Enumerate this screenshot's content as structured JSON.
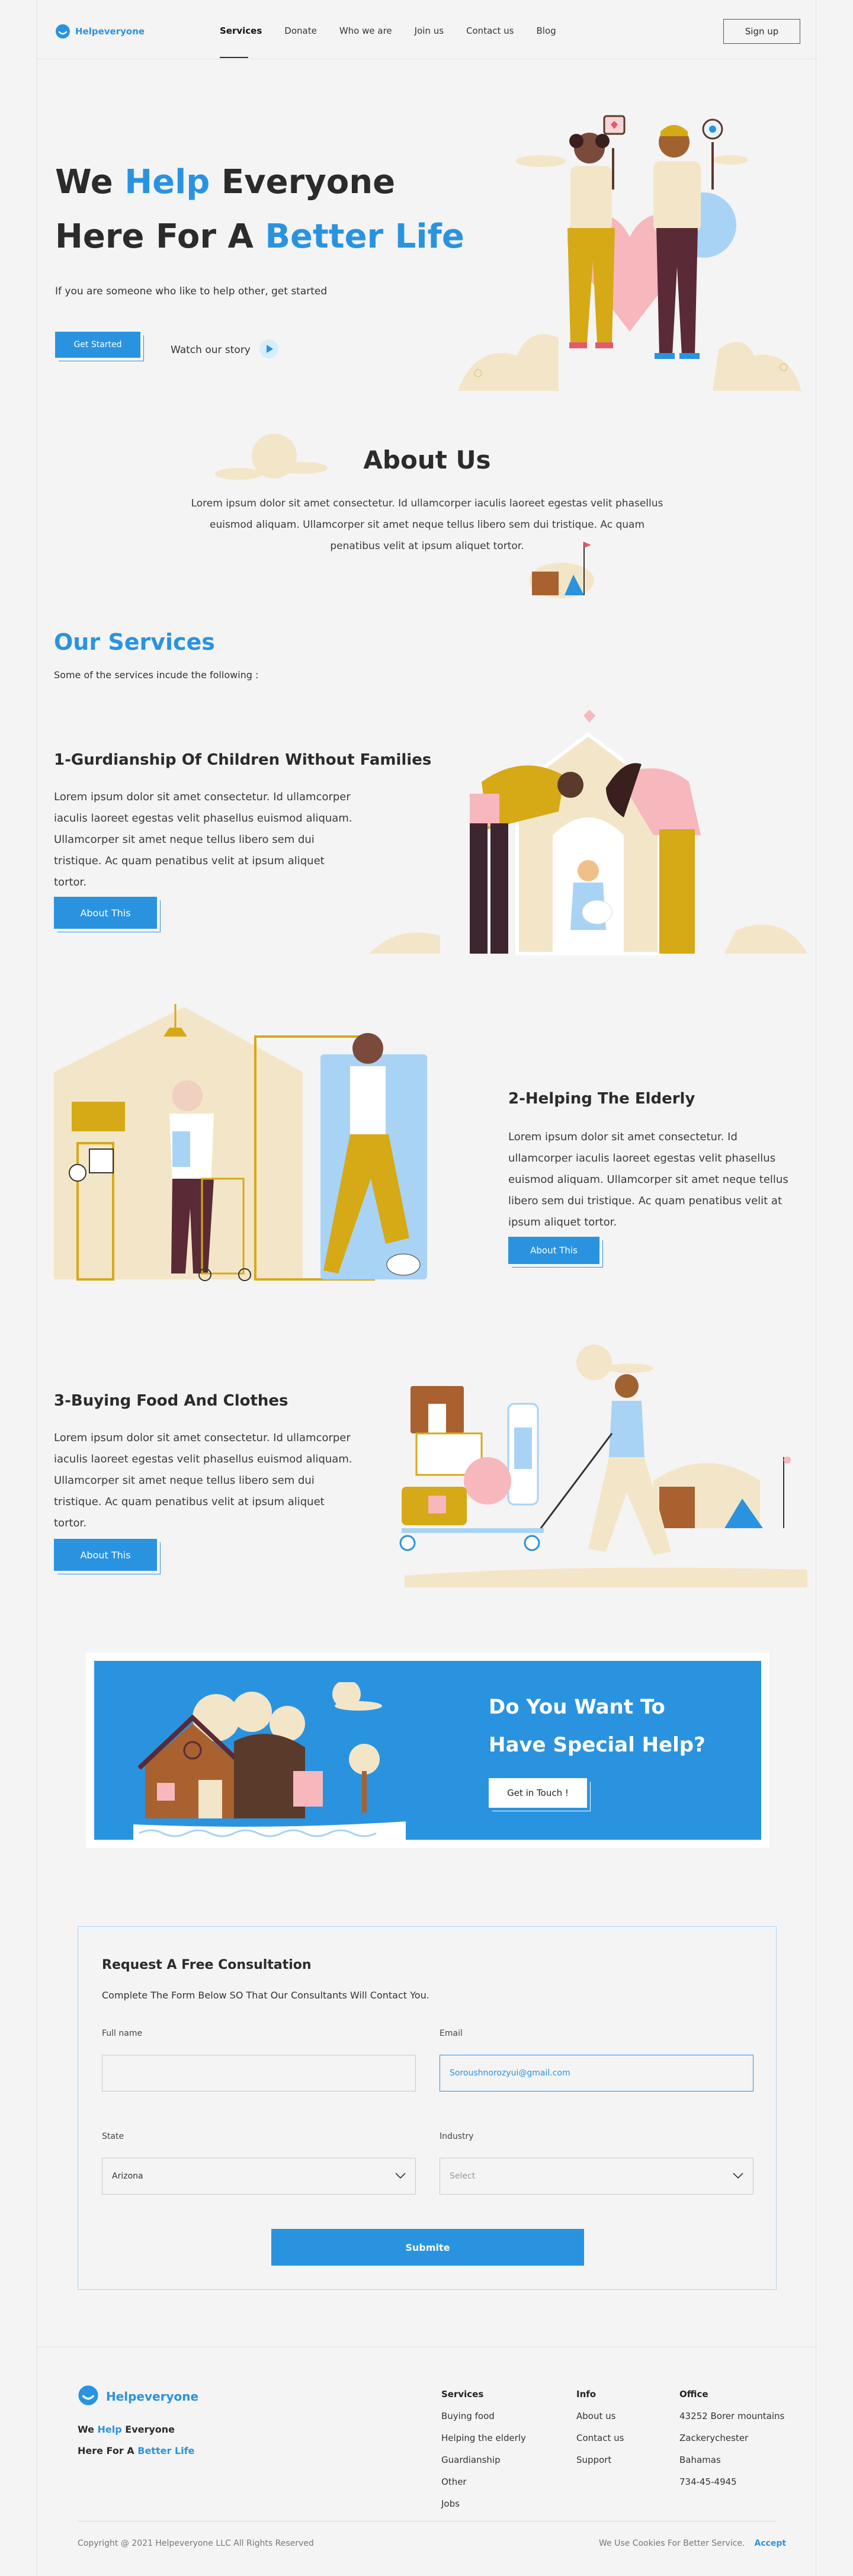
{
  "brand": {
    "name": "Helpeveryone"
  },
  "nav": {
    "items": [
      {
        "label": "Services",
        "active": true
      },
      {
        "label": "Donate"
      },
      {
        "label": "Who we are"
      },
      {
        "label": "Join us"
      },
      {
        "label": "Contact us"
      },
      {
        "label": "Blog"
      }
    ],
    "signup": "Sign up"
  },
  "hero": {
    "line1_a": "We ",
    "line1_b": "Help",
    "line1_c": " Everyone",
    "line2_a": "Here For A ",
    "line2_b": "Better Life",
    "subtitle": "If you are someone who like to help other, get started",
    "cta": "Get Started",
    "watch": "Watch our story"
  },
  "about": {
    "title": "About Us",
    "text": "Lorem ipsum dolor sit amet consectetur. Id ullamcorper iaculis laoreet egestas velit phasellus euismod aliquam. Ullamcorper sit amet neque tellus libero sem dui tristique. Ac quam penatibus velit at ipsum aliquet tortor."
  },
  "services": {
    "title": "Our Services",
    "subtitle": "Some of the services incude the following :",
    "items": [
      {
        "title": "1-Gurdianship Of Children Without Families",
        "text": "Lorem ipsum dolor sit amet consectetur. Id ullamcorper iaculis laoreet egestas velit phasellus euismod aliquam. Ullamcorper sit amet neque tellus libero sem dui tristique. Ac quam penatibus velit at ipsum aliquet tortor.",
        "button": "About This"
      },
      {
        "title": "2-Helping The Elderly",
        "text": "Lorem ipsum dolor sit amet consectetur. Id ullamcorper iaculis laoreet egestas velit phasellus euismod aliquam. Ullamcorper sit amet neque tellus libero sem dui tristique. Ac quam penatibus velit at ipsum aliquet tortor.",
        "button": "About This"
      },
      {
        "title": "3-Buying Food And Clothes",
        "text": "Lorem ipsum dolor sit amet consectetur. Id ullamcorper iaculis laoreet egestas velit phasellus euismod aliquam. Ullamcorper sit amet neque tellus libero sem dui tristique. Ac quam penatibus velit at ipsum aliquet tortor.",
        "button": "About This"
      }
    ]
  },
  "banner": {
    "line1": "Do You Want To",
    "line2": "Have Special Help?",
    "button": "Get in Touch !"
  },
  "form": {
    "title": "Request A Free Consultation",
    "subtitle": "Complete The Form Below SO That Our Consultants Will Contact You.",
    "fullname_label": "Full name",
    "fullname_value": "",
    "email_label": "Email",
    "email_value": "Soroushnorozyui@gmail.com",
    "state_label": "State",
    "state_value": "Arizona",
    "industry_label": "Industry",
    "industry_placeholder": "Select",
    "submit": "Submite"
  },
  "footer": {
    "brand": "Helpeveryone",
    "tag1_a": "We ",
    "tag1_b": "Help",
    "tag1_c": " Everyone",
    "tag2_a": "Here For A ",
    "tag2_b": "Better Life",
    "columns": [
      {
        "heading": "Services",
        "items": [
          "Buying food",
          "Helping the elderly",
          "Guardianship",
          "Other",
          "Jobs"
        ]
      },
      {
        "heading": "Info",
        "items": [
          "About us",
          "Contact us",
          "Support"
        ]
      },
      {
        "heading": "Office",
        "items": [
          "43252 Borer mountains",
          "Zackerychester",
          "Bahamas",
          "734-45-4945"
        ]
      }
    ],
    "copyright": "Copyright @ 2021 Helpeveryone LLC All Rights Reserved",
    "cookies": "We Use Cookies For Better Service.",
    "accept": "Accept"
  },
  "colors": {
    "accent": "#2a93e0",
    "dark": "#2b2b2b",
    "cream": "#f3e6c8",
    "mustard": "#d6a916"
  }
}
